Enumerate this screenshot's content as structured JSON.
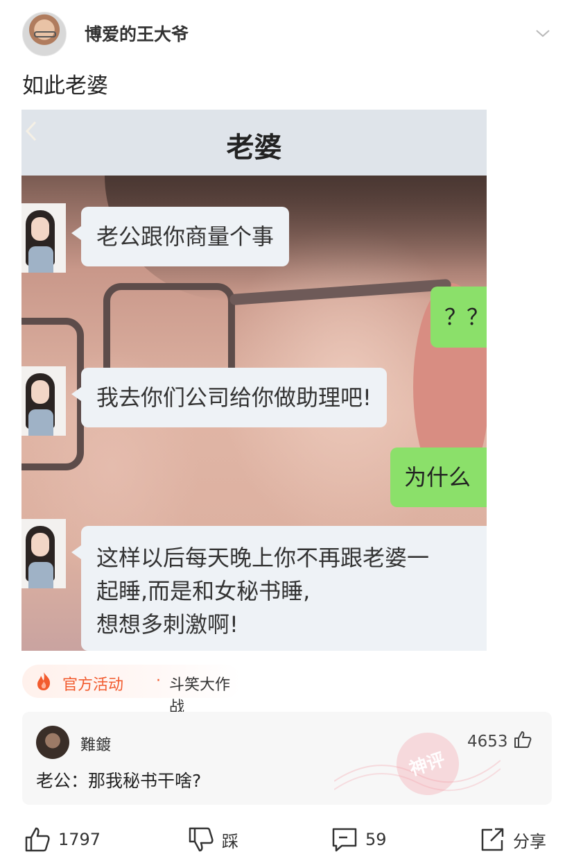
{
  "post": {
    "author": "博爱的王大爷",
    "text": "如此老婆"
  },
  "image": {
    "chat_title": "老婆",
    "messages": [
      {
        "side": "left",
        "text": "老公跟你商量个事"
      },
      {
        "side": "right",
        "text": "？？"
      },
      {
        "side": "left",
        "text": "我去你们公司给你做助理吧!"
      },
      {
        "side": "right",
        "text": "为什么"
      },
      {
        "side": "left",
        "lines": [
          "这样以后每天晚上你不再跟老婆一",
          "起睡,而是和女秘书睡,",
          "想想多刺激啊!"
        ]
      }
    ]
  },
  "activity": {
    "label": "官方活动",
    "dot": "·",
    "name": "斗笑大作战"
  },
  "hot_comment": {
    "user": "難鍍",
    "likes": "4653",
    "text": "老公：那我秘书干啥?",
    "stamp": "神评"
  },
  "actions": {
    "like_count": "1797",
    "dislike_label": "踩",
    "comment_count": "59",
    "share_label": "分享"
  },
  "colors": {
    "accent": "#f25b2e",
    "bubble_green": "#8be06a",
    "bubble_gray": "#eef2f6",
    "comment_bg": "#f7f7f7"
  }
}
